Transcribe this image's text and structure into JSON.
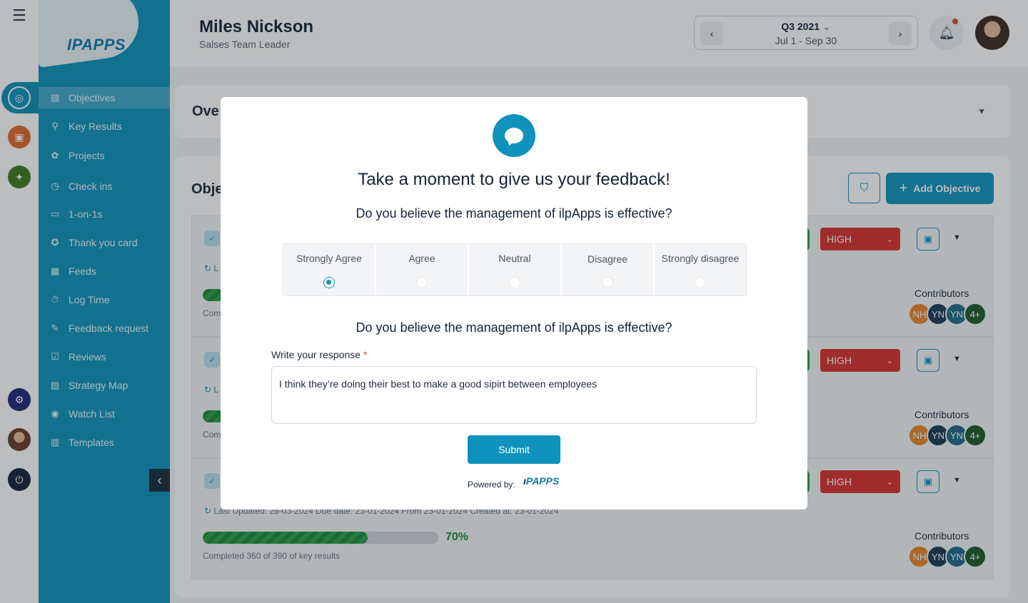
{
  "colors": {
    "brand": "#0f93bd",
    "dark": "#14233a",
    "danger": "#d8312d",
    "success": "#2aa049"
  },
  "logo": {
    "text": "IPAPPS"
  },
  "user": {
    "name": "Miles Nickson",
    "role": "Salses Team Leader"
  },
  "period": {
    "quarter": "Q3 2021",
    "range": "Jul 1 - Sep 30"
  },
  "sidebar": {
    "items": [
      {
        "label": "Objectives",
        "icon": "target-icon"
      },
      {
        "label": "Key Results",
        "icon": "key-results-icon"
      },
      {
        "label": "Projects",
        "icon": "projects-icon"
      },
      {
        "label": "Check ins",
        "icon": "timer-icon"
      },
      {
        "label": "1-on-1s",
        "icon": "chat-icon"
      },
      {
        "label": "Thank you card",
        "icon": "badge-icon"
      },
      {
        "label": "Feeds",
        "icon": "feed-icon"
      },
      {
        "label": "Log Time",
        "icon": "clock-icon"
      },
      {
        "label": "Feedback request",
        "icon": "feedback-icon"
      },
      {
        "label": "Reviews",
        "icon": "review-icon"
      },
      {
        "label": "Strategy Map",
        "icon": "map-icon"
      },
      {
        "label": "Watch List",
        "icon": "eye-icon"
      },
      {
        "label": "Templates",
        "icon": "template-icon"
      }
    ]
  },
  "overview": {
    "title": "Ove"
  },
  "objectives": {
    "title": "Obje",
    "add_label": "Add Objective",
    "rows": [
      {
        "meta": "L",
        "completed": "Com",
        "priority": "HIGH",
        "contributors": "Contributors"
      },
      {
        "meta": "L",
        "completed": "Com",
        "priority": "HIGH",
        "contributors": "Contributors"
      },
      {
        "meta": "Last Updated: 28-03-2024     Due date: 23-01-2024   From 23-01-2024     Created at: 23-01-2024",
        "progress_percent": 70,
        "progress_label": "70%",
        "completed": "Completed 360 of 390 of key results",
        "priority": "HIGH",
        "contributors": "Contributors"
      }
    ],
    "avatars": [
      {
        "initials": "NH",
        "color": "#e8862a"
      },
      {
        "initials": "YN",
        "color": "#183a5a"
      },
      {
        "initials": "YN",
        "color": "#1f6a8a"
      },
      {
        "initials": "4+",
        "color": "#1b5a2a"
      }
    ]
  },
  "modal": {
    "title": "Take a moment to give us your feedback!",
    "question1": "Do you believe the management of ilpApps is effective?",
    "options": [
      "Strongly Agree",
      "Agree",
      "Neutral",
      "Disagree",
      "Strongly disagree"
    ],
    "selected": "Strongly Agree",
    "question2": "Do you believe the management of ilpApps is effective?",
    "response_label": "Write your response",
    "required_mark": "*",
    "response_value": "I think they’re doing their best to make a good sipirt between employees",
    "submit_label": "Submit",
    "powered_by": "Powered by:",
    "powered_logo": "PAPPS"
  }
}
